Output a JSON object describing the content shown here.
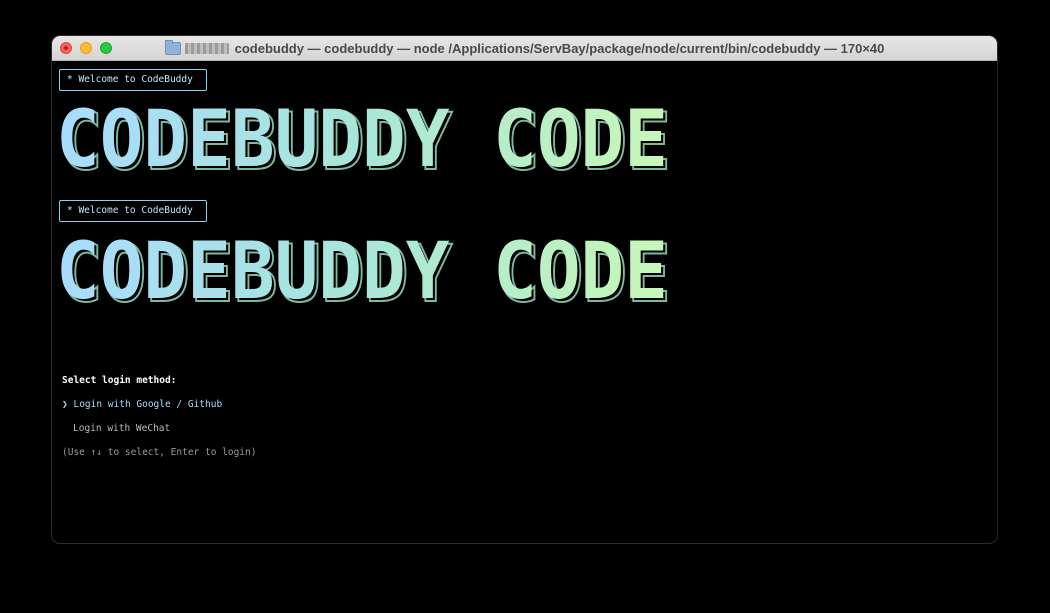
{
  "window": {
    "title": "codebuddy — codebuddy — node /Applications/ServBay/package/node/current/bin/codebuddy — 170×40"
  },
  "terminal": {
    "welcome_1": "* Welcome to CodeBuddy",
    "banner_1": "CODEBUDDY CODE",
    "welcome_2": "* Welcome to CodeBuddy",
    "banner_2": "CODEBUDDY CODE",
    "prompt": "Select login method:",
    "options": [
      {
        "pointer": "❯",
        "label": "Login with Google / Github",
        "selected": true
      },
      {
        "pointer": "",
        "label": "Login with WeChat",
        "selected": false
      }
    ],
    "hint": "(Use ↑↓ to select, Enter to login)"
  },
  "colors": {
    "gradient_start": "#a8dcff",
    "gradient_mid": "#a8e6d8",
    "gradient_end": "#c8f7b8",
    "selected_text": "#a6dcff",
    "border": "#8ad0f0"
  }
}
